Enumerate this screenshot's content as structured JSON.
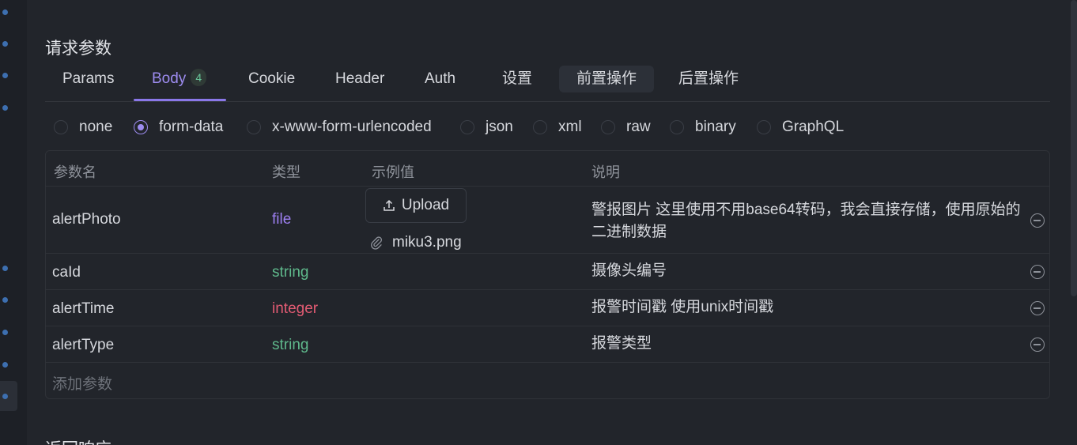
{
  "section_title": "请求参数",
  "tabs": [
    {
      "label": "Params"
    },
    {
      "label": "Body",
      "badge": "4",
      "active": true
    },
    {
      "label": "Cookie"
    },
    {
      "label": "Header"
    },
    {
      "label": "Auth"
    },
    {
      "label": "设置"
    },
    {
      "label": "前置操作",
      "highlighted": true
    },
    {
      "label": "后置操作"
    }
  ],
  "body_types": [
    {
      "label": "none",
      "checked": false
    },
    {
      "label": "form-data",
      "checked": true
    },
    {
      "label": "x-www-form-urlencoded",
      "checked": false
    },
    {
      "label": "json",
      "checked": false
    },
    {
      "label": "xml",
      "checked": false
    },
    {
      "label": "raw",
      "checked": false
    },
    {
      "label": "binary",
      "checked": false
    },
    {
      "label": "GraphQL",
      "checked": false
    }
  ],
  "table": {
    "headers": {
      "name": "参数名",
      "type": "类型",
      "example": "示例值",
      "desc": "说明"
    },
    "rows": [
      {
        "name": "alertPhoto",
        "type": "file",
        "desc": "警报图片 这里使用不用base64转码，我会直接存储，使用原始的二进制数据",
        "upload_label": "Upload",
        "file_name": "miku3.png"
      },
      {
        "name": "caId",
        "type": "string",
        "desc": "摄像头编号"
      },
      {
        "name": "alertTime",
        "type": "integer",
        "desc": "报警时间戳 使用unix时间戳"
      },
      {
        "name": "alertType",
        "type": "string",
        "desc": "报警类型"
      }
    ],
    "add_param": "添加参数"
  },
  "next_section_title": "返回响应",
  "colors": {
    "accent": "#9d8cf0",
    "type_file": "#9d7ff0",
    "type_string": "#5fb98c",
    "type_integer": "#e25b73"
  }
}
